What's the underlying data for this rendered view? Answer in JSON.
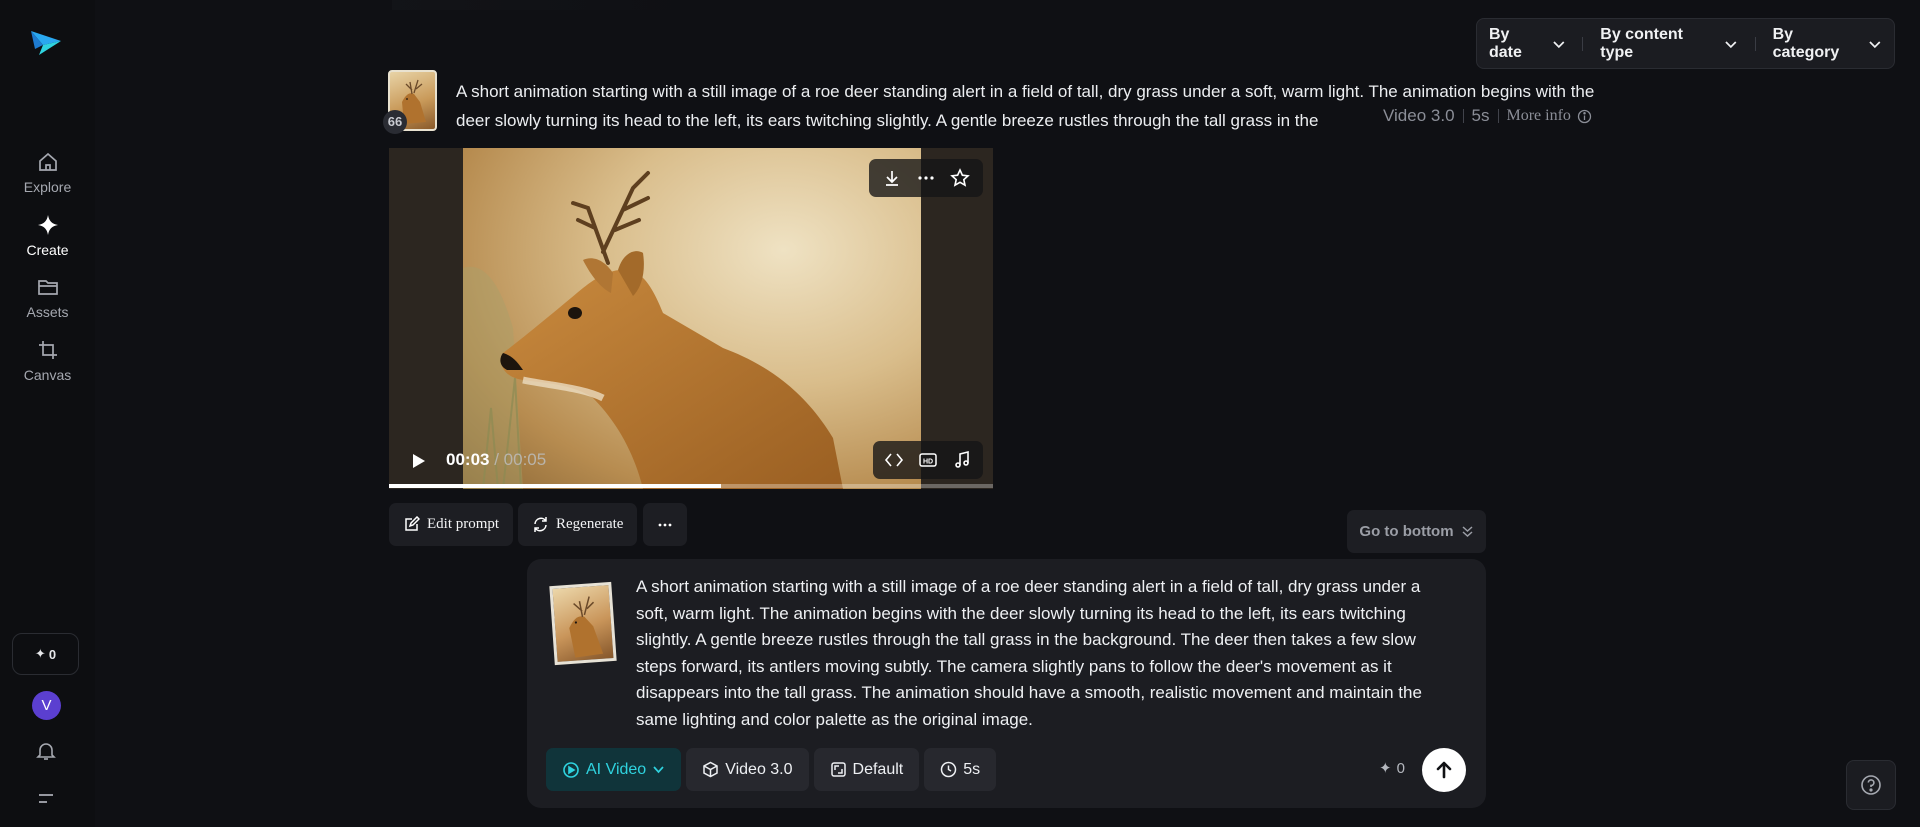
{
  "sidebar": {
    "logo": "app-logo",
    "items": [
      {
        "label": "Explore",
        "icon": "home-icon",
        "active": false
      },
      {
        "label": "Create",
        "icon": "sparkle-icon",
        "active": true
      },
      {
        "label": "Assets",
        "icon": "folder-icon",
        "active": false
      },
      {
        "label": "Canvas",
        "icon": "crop-icon",
        "active": false
      }
    ],
    "credits": "0",
    "avatar_initial": "V"
  },
  "filters": {
    "by_date": "By date",
    "by_content_type": "By content type",
    "by_category": "By category"
  },
  "generation": {
    "quote_icon": "66",
    "prompt": "A short animation starting with a still image of a roe deer standing alert in a field of tall, dry grass under a soft, warm light. The animation begins with the deer slowly turning its head to the left, its ears twitching slightly. A gentle breeze rustles through the tall grass in the",
    "model": "Video 3.0",
    "duration": "5s",
    "more_info": "More info"
  },
  "player": {
    "current_time": "00:03",
    "separator": " / ",
    "total_time": "00:05",
    "progress": 0.55
  },
  "actions": {
    "edit_prompt": "Edit prompt",
    "regenerate": "Regenerate",
    "go_to_bottom": "Go to bottom"
  },
  "composer": {
    "text": "A short animation starting with a still image of a roe deer standing alert in a field of tall, dry grass under a soft, warm light. The animation begins with the deer slowly turning its head to the left, its ears twitching slightly. A gentle breeze rustles through the tall grass in the background. The deer then takes a few slow steps forward, its antlers moving subtly. The camera slightly pans to follow the deer's movement as it disappears into the tall grass. The animation should have a smooth, realistic movement and maintain the same lighting and color palette as the original image.",
    "mode": "AI Video",
    "model": "Video 3.0",
    "aspect": "Default",
    "duration": "5s",
    "credits": "0"
  },
  "colors": {
    "accent": "#2fd3df",
    "background": "#0f1014",
    "avatar": "#5b3fd0"
  }
}
